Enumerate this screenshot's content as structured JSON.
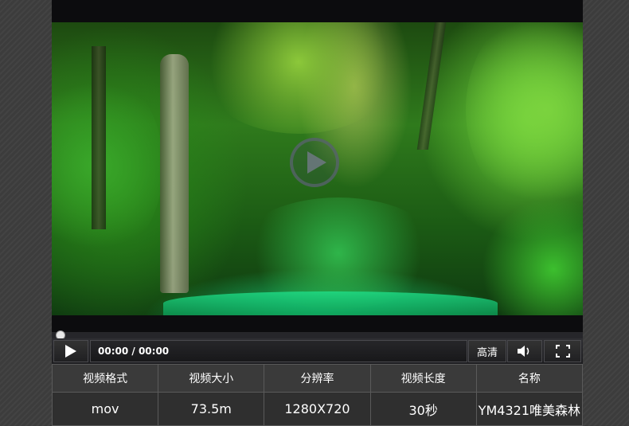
{
  "player": {
    "current_time": "00:00",
    "duration": "00:00",
    "time_separator": " / ",
    "progress_fraction": 0.0,
    "quality_label": "高清",
    "icons": {
      "center_play": "play-circle-icon",
      "play": "play-icon",
      "volume": "volume-icon",
      "fullscreen": "fullscreen-icon"
    }
  },
  "info": {
    "headers": [
      "视频格式",
      "视频大小",
      "分辨率",
      "视频长度",
      "名称"
    ],
    "values": [
      "mov",
      "73.5m",
      "1280X720",
      "30秒",
      "YM4321唯美森林"
    ]
  },
  "colors": {
    "background": "#3c3c3c",
    "player_bg": "#0c0c0e",
    "table_cell": "#333333",
    "text": "#ffffff"
  }
}
